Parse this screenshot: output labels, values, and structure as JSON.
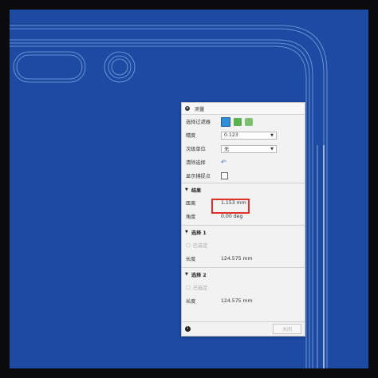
{
  "panel": {
    "title": "测量",
    "rows": {
      "filter": {
        "label": "选择过滤器"
      },
      "precision": {
        "label": "精度",
        "value": "0.123"
      },
      "secondary": {
        "label": "次级单位",
        "value": "无"
      },
      "clear": {
        "label": "清除选择"
      },
      "snap": {
        "label": "显示捕捉点"
      }
    },
    "results": {
      "title": "结果",
      "distance": {
        "label": "距离",
        "value": "1.153 mm"
      },
      "angle": {
        "label": "角度",
        "value": "0.00 deg"
      }
    },
    "selection1": {
      "title": "选择 1",
      "selected_label": "已选定",
      "length": {
        "label": "长度",
        "value": "124.575 mm"
      }
    },
    "selection2": {
      "title": "选择 2",
      "selected_label": "已选定",
      "length": {
        "label": "长度",
        "value": "124.575 mm"
      }
    },
    "footer": {
      "close_label": "关闭"
    }
  },
  "colors": {
    "background": "#1d4aa3",
    "outline": "#7ea5de",
    "highlight": "#e0302a",
    "icon_blue": "#2f8fd8",
    "icon_green": "#57b34d"
  }
}
